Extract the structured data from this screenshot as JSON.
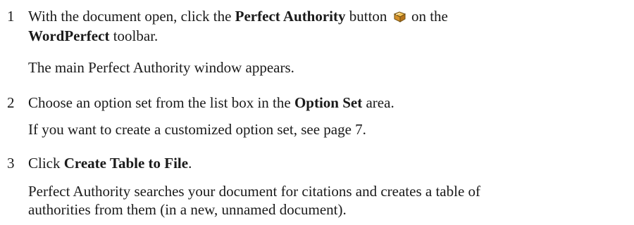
{
  "steps": [
    {
      "number": "1",
      "line1": {
        "t1": "With the document open, click the ",
        "b1": "Perfect Authority",
        "t2": " button",
        "t3": " on the"
      },
      "line2": {
        "b1": "WordPerfect",
        "t1": " toolbar."
      },
      "result": "The main Perfect Authority window appears.",
      "icon": "book-icon"
    },
    {
      "number": "2",
      "line1": {
        "t1": "Choose an option set from the list box in the ",
        "b1": "Option Set",
        "t2": " area."
      },
      "result": "If you want to create a customized option set, see page 7."
    },
    {
      "number": "3",
      "line1": {
        "t1": "Click ",
        "b1": "Create Table to File",
        "t2": "."
      },
      "result_line1": "Perfect Authority searches your document for citations and creates a table of",
      "result_line2": "authorities from them (in a new, unnamed document)."
    }
  ]
}
